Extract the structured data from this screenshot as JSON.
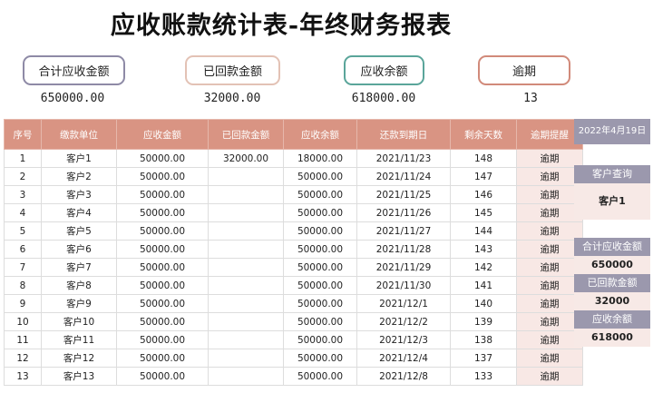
{
  "title": "应收账款统计表-年终财务报表",
  "summary": [
    {
      "label": "合计应收金额",
      "value": "650000.00",
      "color": "#8e8aa6"
    },
    {
      "label": "已回款金额",
      "value": "32000.00",
      "color": "#e3c2b5"
    },
    {
      "label": "应收余额",
      "value": "618000.00",
      "color": "#5aa59a"
    },
    {
      "label": "逾期",
      "value": "13",
      "color": "#d18a7a"
    }
  ],
  "table": {
    "headers": [
      "序号",
      "缴款单位",
      "应收金额",
      "已回款金额",
      "应收余额",
      "还款到期日",
      "剩余天数",
      "逾期提醒"
    ],
    "rows": [
      [
        "1",
        "客户1",
        "50000.00",
        "32000.00",
        "18000.00",
        "2021/11/23",
        "148",
        "逾期"
      ],
      [
        "2",
        "客户2",
        "50000.00",
        "",
        "50000.00",
        "2021/11/24",
        "147",
        "逾期"
      ],
      [
        "3",
        "客户3",
        "50000.00",
        "",
        "50000.00",
        "2021/11/25",
        "146",
        "逾期"
      ],
      [
        "4",
        "客户4",
        "50000.00",
        "",
        "50000.00",
        "2021/11/26",
        "145",
        "逾期"
      ],
      [
        "5",
        "客户5",
        "50000.00",
        "",
        "50000.00",
        "2021/11/27",
        "144",
        "逾期"
      ],
      [
        "6",
        "客户6",
        "50000.00",
        "",
        "50000.00",
        "2021/11/28",
        "143",
        "逾期"
      ],
      [
        "7",
        "客户7",
        "50000.00",
        "",
        "50000.00",
        "2021/11/29",
        "142",
        "逾期"
      ],
      [
        "8",
        "客户8",
        "50000.00",
        "",
        "50000.00",
        "2021/11/30",
        "141",
        "逾期"
      ],
      [
        "9",
        "客户9",
        "50000.00",
        "",
        "50000.00",
        "2021/12/1",
        "140",
        "逾期"
      ],
      [
        "10",
        "客户10",
        "50000.00",
        "",
        "50000.00",
        "2021/12/2",
        "139",
        "逾期"
      ],
      [
        "11",
        "客户11",
        "50000.00",
        "",
        "50000.00",
        "2021/12/3",
        "138",
        "逾期"
      ],
      [
        "12",
        "客户12",
        "50000.00",
        "",
        "50000.00",
        "2021/12/4",
        "137",
        "逾期"
      ],
      [
        "13",
        "客户13",
        "50000.00",
        "",
        "50000.00",
        "2021/12/8",
        "133",
        "逾期"
      ]
    ]
  },
  "side": {
    "date": "2022年4月19日",
    "query_label": "客户查询",
    "query_value": "客户1",
    "receivable_label": "合计应收金额",
    "receivable_value": "650000",
    "returned_label": "已回款金额",
    "returned_value": "32000",
    "balance_label": "应收余额",
    "balance_value": "618000"
  }
}
